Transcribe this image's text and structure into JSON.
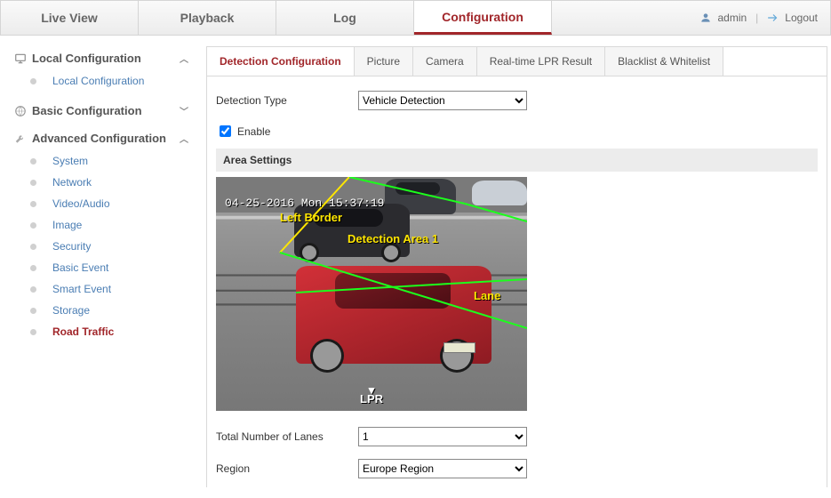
{
  "topnav": {
    "tabs": [
      "Live View",
      "Playback",
      "Log",
      "Configuration"
    ],
    "active_index": 3,
    "user": "admin",
    "logout": "Logout"
  },
  "sidebar": {
    "groups": [
      {
        "label": "Local Configuration",
        "expanded": true,
        "icon": "monitor",
        "items": [
          "Local Configuration"
        ],
        "active_item": null
      },
      {
        "label": "Basic Configuration",
        "expanded": false,
        "icon": "globe",
        "items": [],
        "active_item": null
      },
      {
        "label": "Advanced Configuration",
        "expanded": true,
        "icon": "wrench",
        "items": [
          "System",
          "Network",
          "Video/Audio",
          "Image",
          "Security",
          "Basic Event",
          "Smart Event",
          "Storage",
          "Road Traffic"
        ],
        "active_item": 8
      }
    ]
  },
  "subtabs": {
    "items": [
      "Detection Configuration",
      "Picture",
      "Camera",
      "Real-time LPR Result",
      "Blacklist & Whitelist"
    ],
    "active_index": 0
  },
  "form": {
    "detection_type_label": "Detection Type",
    "detection_type_value": "Vehicle Detection",
    "enable_label": "Enable",
    "enable_checked": true,
    "area_settings_label": "Area Settings",
    "osd_timestamp": "04-25-2016 Mon 15:37:19",
    "overlay": {
      "left_border": "Left Border",
      "detection_area": "Detection Area 1",
      "lane": "Lane",
      "lpr": "LPR"
    },
    "total_lanes_label": "Total Number of Lanes",
    "total_lanes_value": "1",
    "region_label": "Region",
    "region_value": "Europe Region"
  }
}
